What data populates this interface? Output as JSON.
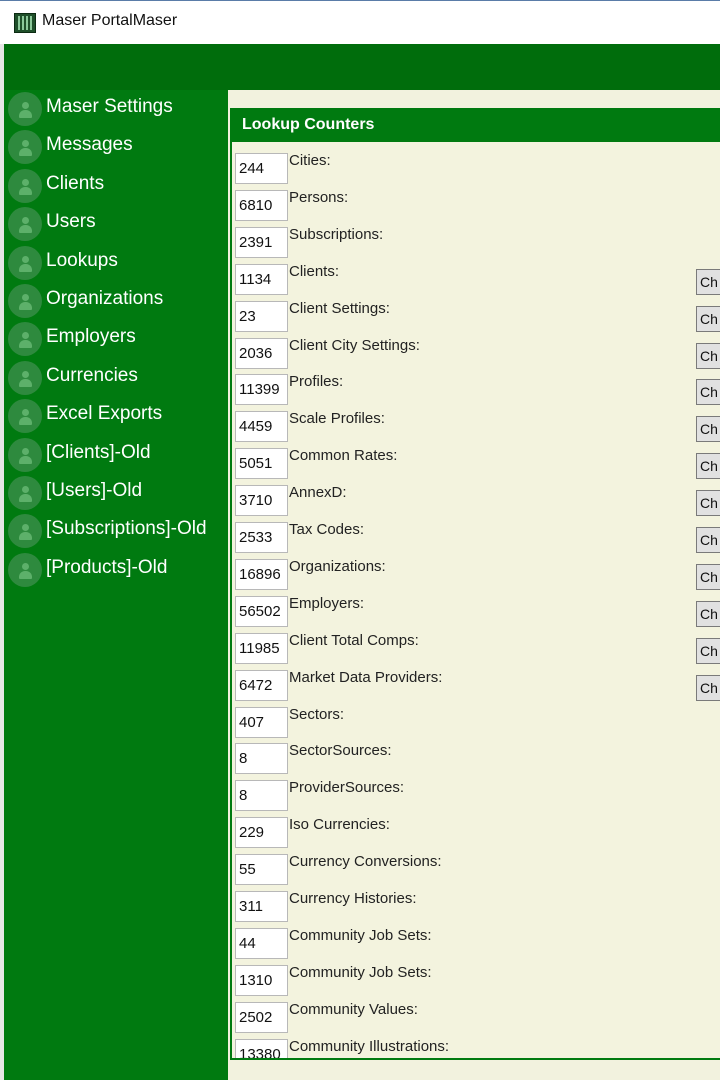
{
  "window": {
    "title": "Maser PortalMaser",
    "icon": "app-logo-icon"
  },
  "sidebar": {
    "items": [
      {
        "label": "Maser Settings"
      },
      {
        "label": "Messages"
      },
      {
        "label": "Clients"
      },
      {
        "label": "Users"
      },
      {
        "label": "Lookups"
      },
      {
        "label": "Organizations"
      },
      {
        "label": "Employers"
      },
      {
        "label": "Currencies"
      },
      {
        "label": "Excel Exports"
      },
      {
        "label": "[Clients]-Old"
      },
      {
        "label": "[Users]-Old"
      },
      {
        "label": "[Subscriptions]-Old"
      },
      {
        "label": "[Products]-Old"
      }
    ],
    "item_icon": "person-icon"
  },
  "panel": {
    "title": "Lookup Counters",
    "button_label": "Ch",
    "rows": [
      {
        "count": "244",
        "label": "Cities:",
        "has_button": false
      },
      {
        "count": "6810",
        "label": "Persons:",
        "has_button": false
      },
      {
        "count": "2391",
        "label": "Subscriptions:",
        "has_button": false
      },
      {
        "count": "1134",
        "label": "Clients:",
        "has_button": true
      },
      {
        "count": "23",
        "label": "Client Settings:",
        "has_button": true
      },
      {
        "count": "2036",
        "label": "Client City Settings:",
        "has_button": true
      },
      {
        "count": "11399",
        "label": "Profiles:",
        "has_button": true
      },
      {
        "count": "4459",
        "label": "Scale Profiles:",
        "has_button": true
      },
      {
        "count": "5051",
        "label": "Common Rates:",
        "has_button": true
      },
      {
        "count": "3710",
        "label": "AnnexD:",
        "has_button": true
      },
      {
        "count": "2533",
        "label": "Tax Codes:",
        "has_button": true
      },
      {
        "count": "16896",
        "label": "Organizations:",
        "has_button": true
      },
      {
        "count": "56502",
        "label": "Employers:",
        "has_button": true
      },
      {
        "count": "11985",
        "label": "Client Total Comps:",
        "has_button": true
      },
      {
        "count": "6472",
        "label": "Market Data Providers:",
        "has_button": true
      },
      {
        "count": "407",
        "label": "Sectors:",
        "has_button": false
      },
      {
        "count": "8",
        "label": "SectorSources:",
        "has_button": false
      },
      {
        "count": "8",
        "label": "ProviderSources:",
        "has_button": false
      },
      {
        "count": "229",
        "label": "Iso Currencies:",
        "has_button": false
      },
      {
        "count": "55",
        "label": "Currency Conversions:",
        "has_button": false
      },
      {
        "count": "311",
        "label": "Currency Histories:",
        "has_button": false
      },
      {
        "count": "44",
        "label": "Community Job Sets:",
        "has_button": false
      },
      {
        "count": "1310",
        "label": "Community Job Sets:",
        "has_button": false
      },
      {
        "count": "2502",
        "label": "Community Values:",
        "has_button": false
      },
      {
        "count": "13380",
        "label": "Community Illustrations:",
        "has_button": false
      }
    ]
  },
  "colors": {
    "sidebar": "#007a10",
    "header": "#006d0c",
    "panel_bg": "#f3f3de",
    "text_light": "#ffffff"
  }
}
